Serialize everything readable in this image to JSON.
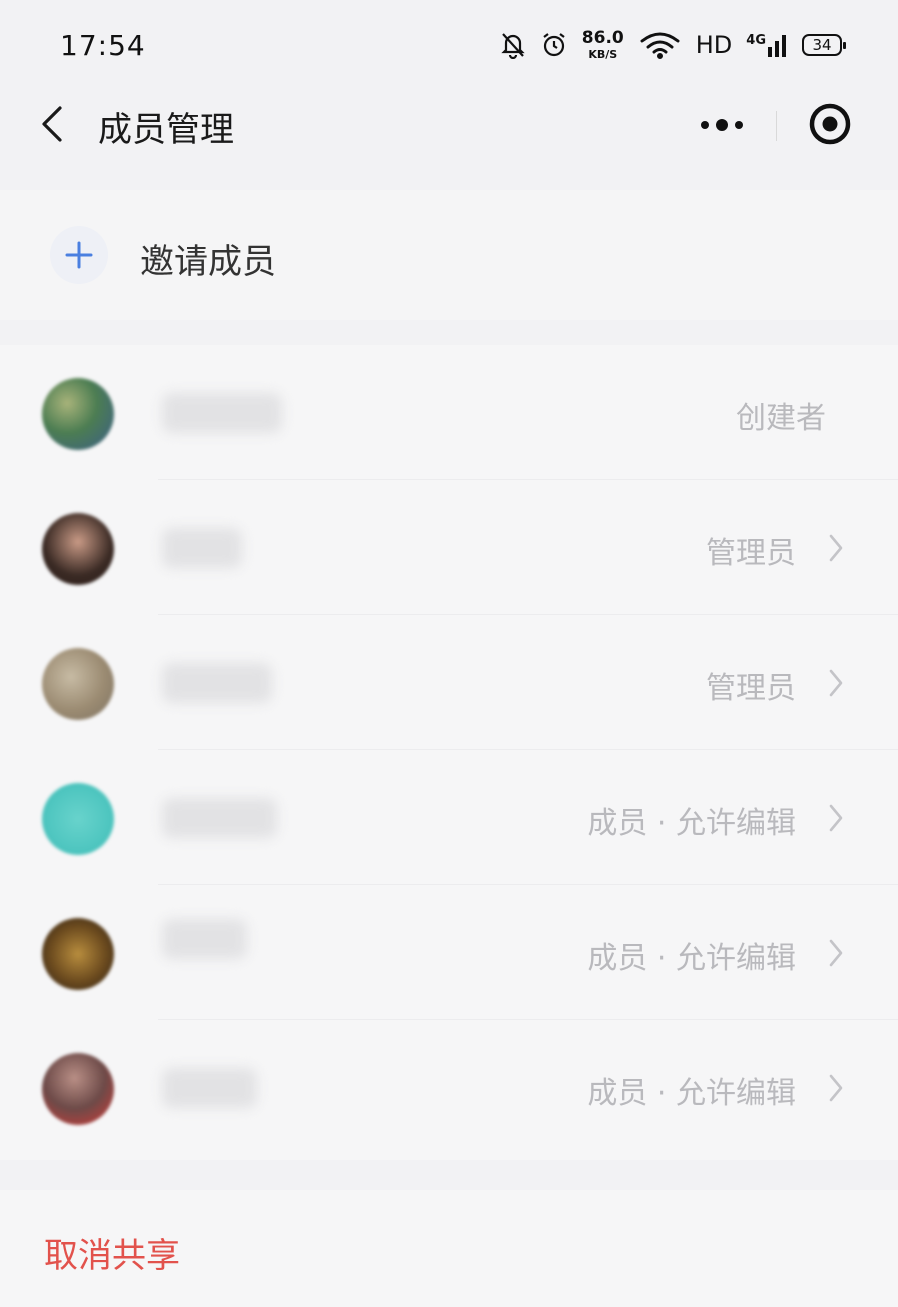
{
  "status_bar": {
    "time": "17:54",
    "net_speed_value": "86.0",
    "net_speed_unit": "KB/S",
    "hd_label": "HD",
    "signal_label": "4G",
    "battery": "34",
    "icons": [
      "bell-off-icon",
      "alarm-icon",
      "wifi-icon",
      "signal-icon",
      "battery-icon"
    ]
  },
  "nav": {
    "title": "成员管理",
    "back_icon": "chevron-left-icon",
    "more_icon": "more-dots-icon",
    "close_icon": "target-close-icon"
  },
  "invite": {
    "label": "邀请成员",
    "icon": "plus-icon",
    "icon_color": "#4a7fe0"
  },
  "members": [
    {
      "role": "创建者",
      "has_chevron": false,
      "avatar_colors": [
        "#4c7d52",
        "#a8b37a",
        "#3b5d8a"
      ]
    },
    {
      "role": "管理员",
      "has_chevron": true,
      "avatar_colors": [
        "#3a2a24",
        "#c99a86",
        "#d8363a"
      ]
    },
    {
      "role": "管理员",
      "has_chevron": true,
      "avatar_colors": [
        "#9b8b72",
        "#c7bba4",
        "#7d7262"
      ]
    },
    {
      "role": "成员 · 允许编辑",
      "has_chevron": true,
      "avatar_colors": [
        "#4fc6c0",
        "#68d3cc",
        "#3fb7b1"
      ]
    },
    {
      "role": "成员 · 允许编辑",
      "has_chevron": true,
      "avatar_colors": [
        "#6b4a1e",
        "#b88d3e",
        "#2d2118"
      ]
    },
    {
      "role": "成员 · 允许编辑",
      "has_chevron": true,
      "avatar_colors": [
        "#6d4a48",
        "#b98f86",
        "#d43b38"
      ]
    }
  ],
  "actions": {
    "cancel_share": "取消共享",
    "cancel_color": "#e2524c"
  }
}
